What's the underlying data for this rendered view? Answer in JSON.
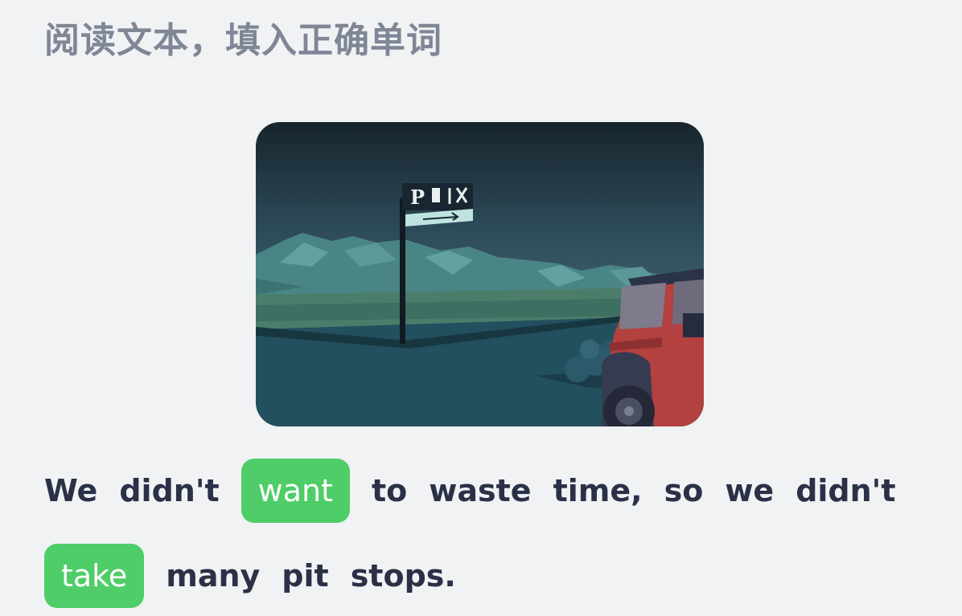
{
  "header": {
    "title": "阅读文本，填入正确单词"
  },
  "illustration": {
    "sign_text": "P",
    "icons": [
      "fuel-pump-icon",
      "fork-knife-icon",
      "right-arrow-icon"
    ],
    "colors": {
      "sky_top": "#1c2b33",
      "sky_bottom": "#4a6f80",
      "mountains": "#4d8a8a",
      "ground": "#23505f",
      "jeep": "#b2413f"
    }
  },
  "exercise": {
    "line1": {
      "w1": "We",
      "w2": "didn't",
      "answer1": "want",
      "w3": "to",
      "w4": "waste",
      "w5": "time,",
      "w6": "so",
      "w7": "we",
      "w8": "didn't"
    },
    "line2": {
      "answer2": "take",
      "w1": "many",
      "w2": "pit",
      "w3": "stops."
    },
    "colors": {
      "chip": "#4fcd68",
      "text": "#2a3147"
    }
  }
}
